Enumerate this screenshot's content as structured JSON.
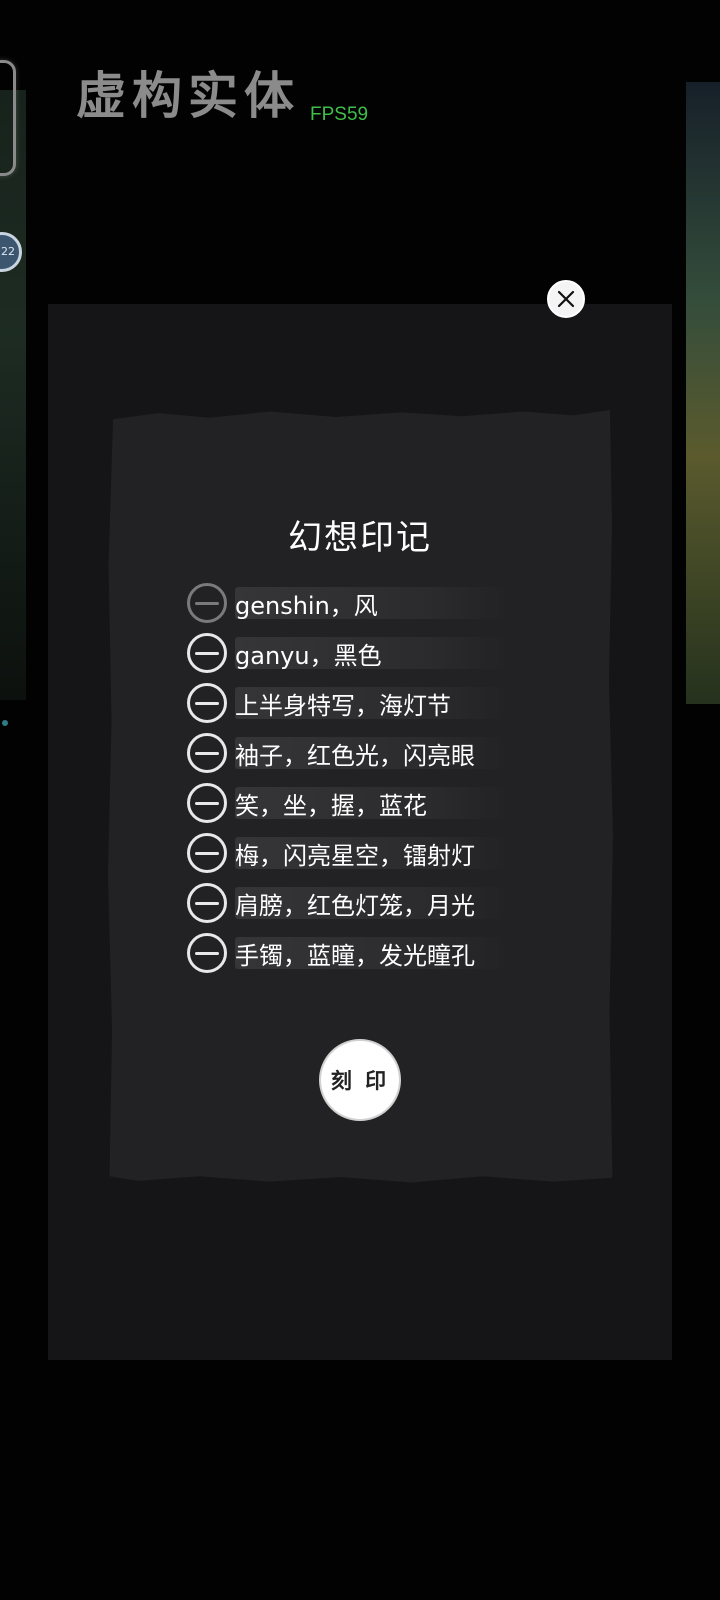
{
  "app": {
    "title": "虚构实体",
    "fps": "FPS59",
    "badge_number": "22"
  },
  "dialog": {
    "title": "幻想印记",
    "close_icon": "close-icon",
    "tags": [
      {
        "text": "genshin，风",
        "active": false
      },
      {
        "text": "ganyu，黑色",
        "active": true
      },
      {
        "text": "上半身特写，海灯节",
        "active": true
      },
      {
        "text": "袖子，红色光，闪亮眼",
        "active": true
      },
      {
        "text": "笑，坐，握，蓝花",
        "active": true
      },
      {
        "text": "梅，闪亮星空，镭射灯",
        "active": true
      },
      {
        "text": "肩膀，红色灯笼，月光",
        "active": true
      },
      {
        "text": "手镯，蓝瞳，发光瞳孔",
        "active": true
      }
    ],
    "engrave_label": "刻 印"
  },
  "colors": {
    "fps": "#3fbf4a",
    "title": "#8b8b8b",
    "card": "#222224",
    "backdrop": "#151517"
  }
}
